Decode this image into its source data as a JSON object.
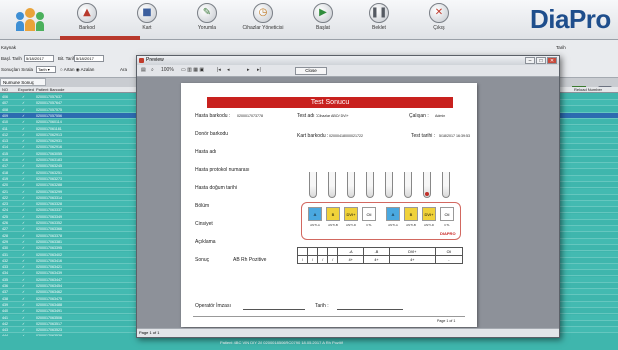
{
  "toolbar": {
    "brand": "DiaPro",
    "buttons": [
      {
        "label": "Barkod",
        "icon": "barcode-icon",
        "glyph": "▲",
        "color": "#b8392c"
      },
      {
        "label": "Kart",
        "icon": "card-icon",
        "glyph": "■",
        "color": "#3c5f9e"
      },
      {
        "label": "Yorumla",
        "icon": "pen-icon",
        "glyph": "✎",
        "color": "#3c7a3c"
      },
      {
        "label": "Cihazlar Yöneticisi",
        "icon": "clock-icon",
        "glyph": "◷",
        "color": "#c0781f"
      },
      {
        "label": "Başlat",
        "icon": "play-icon",
        "glyph": "▶",
        "color": "#2f8c3b"
      },
      {
        "label": "Beklet",
        "icon": "pause-icon",
        "glyph": "❚❚",
        "color": "#555a62"
      },
      {
        "label": "Çıkış",
        "icon": "exit-icon",
        "glyph": "✕",
        "color": "#c0392b"
      }
    ]
  },
  "filters": {
    "start_label": "Başl. Tarih",
    "start_value": "5/18/2017",
    "end_label": "Bit. Tarih",
    "end_value": "5/18/2017",
    "arrange_label": "Sonuçları Sırala",
    "search_label": "Ara",
    "print_label": "Yazdır",
    "select_label": "Tarih"
  },
  "tab": {
    "label": "Numune Sonuç"
  },
  "grid": {
    "headers": [
      "NO",
      "Exported",
      "Patient Barcode",
      "Reload Number"
    ],
    "rows": [
      {
        "no": "406",
        "exp": "✓",
        "barcode": "0200017057637"
      },
      {
        "no": "407",
        "exp": "✓",
        "barcode": "0200017057647"
      },
      {
        "no": "408",
        "exp": "✓",
        "barcode": "0200017057575"
      },
      {
        "no": "409",
        "exp": "✓",
        "barcode": "0200017057556"
      },
      {
        "no": "410",
        "exp": "✓",
        "barcode": "0200017060114"
      },
      {
        "no": "411",
        "exp": "✓",
        "barcode": "0200017061181"
      },
      {
        "no": "412",
        "exp": "✓",
        "barcode": "0200017062913"
      },
      {
        "no": "413",
        "exp": "✓",
        "barcode": "0200017062931"
      },
      {
        "no": "414",
        "exp": "✓",
        "barcode": "0200017062916"
      },
      {
        "no": "415",
        "exp": "✓",
        "barcode": "0200017063055"
      },
      {
        "no": "416",
        "exp": "✓",
        "barcode": "0200017063183"
      },
      {
        "no": "417",
        "exp": "✓",
        "barcode": "0200017063245"
      },
      {
        "no": "418",
        "exp": "✓",
        "barcode": "0200017063251"
      },
      {
        "no": "419",
        "exp": "✓",
        "barcode": "0200017063273"
      },
      {
        "no": "420",
        "exp": "✓",
        "barcode": "0200017063288"
      },
      {
        "no": "421",
        "exp": "✓",
        "barcode": "0200017063299"
      },
      {
        "no": "422",
        "exp": "✓",
        "barcode": "0200017063314"
      },
      {
        "no": "423",
        "exp": "✓",
        "barcode": "0200017063328"
      },
      {
        "no": "424",
        "exp": "✓",
        "barcode": "0200017063337"
      },
      {
        "no": "425",
        "exp": "✓",
        "barcode": "0200017063349"
      },
      {
        "no": "426",
        "exp": "✓",
        "barcode": "0200017063352"
      },
      {
        "no": "427",
        "exp": "✓",
        "barcode": "0200017063366"
      },
      {
        "no": "428",
        "exp": "✓",
        "barcode": "0200017063378"
      },
      {
        "no": "429",
        "exp": "✓",
        "barcode": "0200017063381"
      },
      {
        "no": "430",
        "exp": "✓",
        "barcode": "0200017063395"
      },
      {
        "no": "431",
        "exp": "✓",
        "barcode": "0200017063402"
      },
      {
        "no": "432",
        "exp": "✓",
        "barcode": "0200017063416"
      },
      {
        "no": "433",
        "exp": "✓",
        "barcode": "0200017063421"
      },
      {
        "no": "434",
        "exp": "✓",
        "barcode": "0200017063439"
      },
      {
        "no": "435",
        "exp": "✓",
        "barcode": "0200017063447"
      },
      {
        "no": "436",
        "exp": "✓",
        "barcode": "0200017063454"
      },
      {
        "no": "437",
        "exp": "✓",
        "barcode": "0200017063462"
      },
      {
        "no": "438",
        "exp": "✓",
        "barcode": "0200017063475"
      },
      {
        "no": "439",
        "exp": "✓",
        "barcode": "0200017063488"
      },
      {
        "no": "440",
        "exp": "✓",
        "barcode": "0200017063491"
      },
      {
        "no": "441",
        "exp": "✓",
        "barcode": "0200017063506"
      },
      {
        "no": "442",
        "exp": "✓",
        "barcode": "0200017063517"
      },
      {
        "no": "443",
        "exp": "✓",
        "barcode": "0200017063523"
      },
      {
        "no": "444",
        "exp": "✓",
        "barcode": "0200017063538"
      },
      {
        "no": "445",
        "exp": "✓",
        "barcode": "0200017063546"
      }
    ],
    "bottom_text": "Patient 4BC VIN DIY 2/l  0200018506RC0790  18.05.2017  A Rh Pozitif"
  },
  "preview": {
    "title": "Preview",
    "zoom": "100%",
    "close_label": "Close",
    "status": "Page 1 of 1",
    "page_count": "Page 1 of 1"
  },
  "report": {
    "title": "Test Sonucu",
    "hasta_barkodu_label": "Hasta barkodu :",
    "hasta_barkodu_value": "0200017073778",
    "test_adi_label": "Test adı :",
    "test_adi_value": "Cihazlar ABO/ DVI+",
    "calisan_label": "Çalışan :",
    "calisan_value": "Admin",
    "donor_label": "Donör barkodu",
    "kart_label": "Kart barkodu :",
    "kart_value": "02000418000021722",
    "test_tarihi_label": "Test tarihi :",
    "test_tarihi_value": "5/18/2017 16:39:53",
    "hasta_adi_label": "Hasta adı",
    "protokol_label": "Hasta protokol numarası",
    "dogum_label": "Hasta doğum tarihi",
    "bolum_label": "Bölüm",
    "cinsiyet_label": "Cinsiyet",
    "aciklama_label": "Açıklama",
    "sonuc_label": "Sonuç",
    "sonuc_value": "AB Rh Pozitive",
    "wells": [
      {
        "label": "ANTI-A",
        "sym": "A",
        "color": "#4aa8e0"
      },
      {
        "label": "ANTI-B",
        "sym": "B",
        "color": "#f0d23a"
      },
      {
        "label": "ANTI-D",
        "sym": "DVI+",
        "color": "#f0d23a"
      },
      {
        "label": "CTL",
        "sym": "Ctl",
        "color": "#ffffff"
      },
      {
        "label": "ANTI-A",
        "sym": "A",
        "color": "#4aa8e0"
      },
      {
        "label": "ANTI-B",
        "sym": "B",
        "color": "#f0d23a"
      },
      {
        "label": "ANTI-D",
        "sym": "DVI+",
        "color": "#f0d23a"
      },
      {
        "label": "CTL",
        "sym": "Ctl",
        "color": "#ffffff"
      }
    ],
    "card_logo": "DIAPRO",
    "table_head": [
      "",
      "",
      "",
      "",
      "-A",
      "-B",
      "DVI+",
      "Ctl"
    ],
    "table_vals": [
      "/",
      "/",
      "/",
      "/",
      "4+",
      "4+",
      "4+",
      "-"
    ],
    "operator_label": "Operatör İmzası",
    "tarih_label": "Tarih :",
    "page_footer": "Page 1 of 1"
  }
}
